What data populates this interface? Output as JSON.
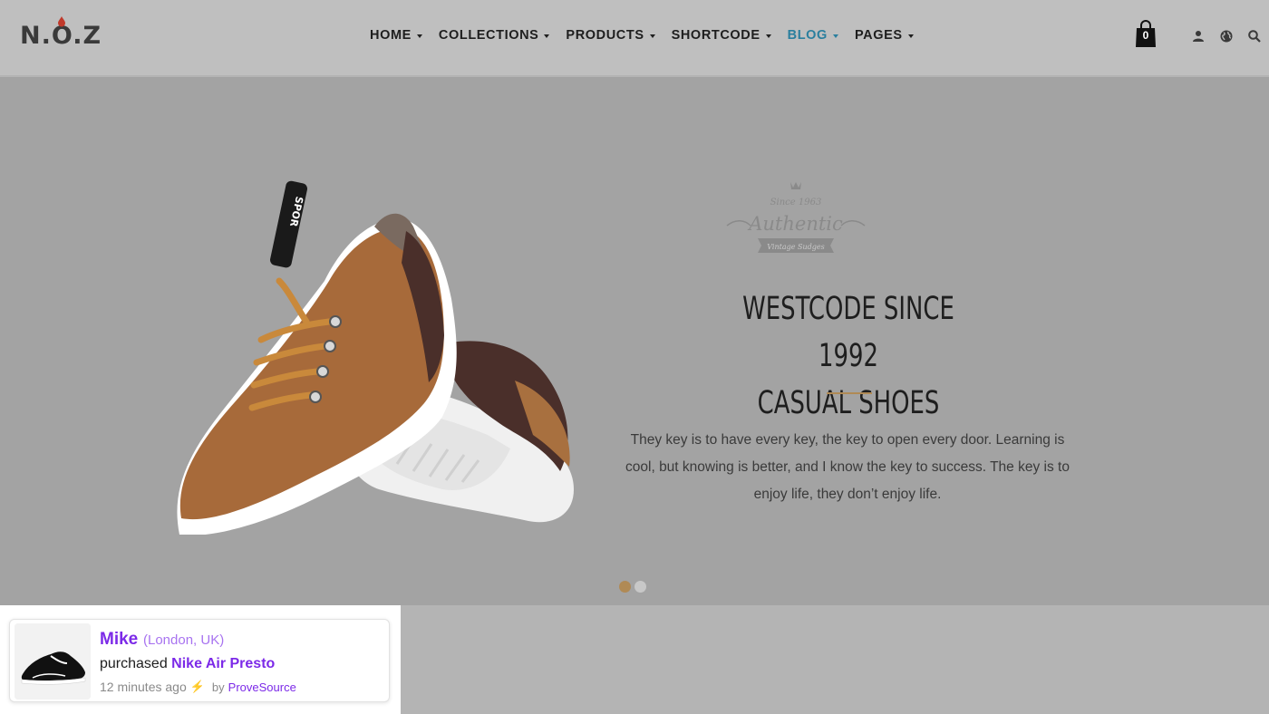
{
  "header": {
    "logo": "N.O.Z",
    "nav": [
      {
        "label": "HOME",
        "active": false
      },
      {
        "label": "COLLECTIONS",
        "active": false
      },
      {
        "label": "PRODUCTS",
        "active": false
      },
      {
        "label": "SHORTCODE",
        "active": false
      },
      {
        "label": "BLOG",
        "active": true
      },
      {
        "label": "PAGES",
        "active": false
      }
    ],
    "cart_count": "0",
    "icons": [
      "user-icon",
      "globe-icon",
      "search-icon"
    ]
  },
  "hero": {
    "badge": "Authentic",
    "badge_since": "Since 1963",
    "badge_ribbon": "Vintage Sudges",
    "shoe_tongue_text": "SPOR",
    "headline_line1": "WESTCODE SINCE 1992",
    "headline_line2": "CASUAL SHOES",
    "description": "They key is to have every key, the key to open every door. Learning is cool, but knowing is better, and I know the key to success. The key is to enjoy life, they don’t enjoy life.",
    "slides": [
      {
        "active": true
      },
      {
        "active": false
      }
    ]
  },
  "notification": {
    "name": "Mike",
    "location": "(London, UK)",
    "action": "purchased",
    "product": "Nike Air Presto",
    "time": "12 minutes ago",
    "by_label": "by",
    "brand": "ProveSource"
  },
  "colors": {
    "accent": "#2a7f9e",
    "gold": "#b08a55",
    "purple": "#7c2ae8"
  }
}
